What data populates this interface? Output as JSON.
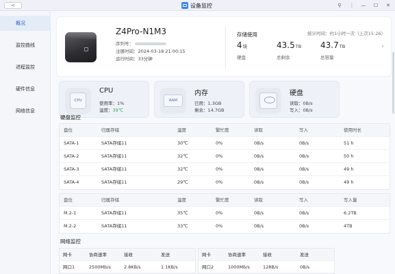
{
  "titlebar": {
    "back": "<",
    "title": "设备监控",
    "controls": [
      "⚲",
      "⋮",
      "—",
      "☐",
      "✕"
    ]
  },
  "sidebar": {
    "items": [
      {
        "label": "概况",
        "active": true
      },
      {
        "label": "监控曲线"
      },
      {
        "label": "进程监控"
      },
      {
        "label": "硬件信息"
      },
      {
        "label": "网络信息"
      }
    ]
  },
  "device": {
    "model": "Z4Pro-N1M3",
    "serial_label": "序列号：",
    "register_label": "注册时间：",
    "register_time": "2024-03-18 21:00:15",
    "uptime_label": "运行时间：",
    "uptime": "33分钟"
  },
  "storage": {
    "title": "存储使用",
    "stat_time": "统计时间：约1小时一次（上次15:26）",
    "disks": {
      "value": "4",
      "unit": "块",
      "label": "硬盘"
    },
    "remaining": {
      "value": "43.5",
      "unit": "TB",
      "label": "总剩余"
    },
    "capacity": {
      "value": "43.7",
      "unit": "TB",
      "label": "总容量"
    },
    "chevron": "›"
  },
  "resources": {
    "cpu": {
      "title": "CPU",
      "chip_text": "CPU",
      "usage_label": "使用率：",
      "usage": "1%",
      "temp_label": "温度：",
      "temp": "39℃"
    },
    "memory": {
      "title": "内存",
      "chip_text": "RAM",
      "used_label": "已用：",
      "used": "1.3GB",
      "free_label": "剩余：",
      "free": "14.7GB"
    },
    "disk": {
      "title": "硬盘",
      "read_label": "读取：",
      "read": "0B/s",
      "write_label": "写入：",
      "write": "0B/s"
    }
  },
  "disk_monitor": {
    "title": "硬盘监控",
    "sata_headers": [
      "盘位",
      "归属存储",
      "温度",
      "繁忙度",
      "读取",
      "写入",
      "使用时长"
    ],
    "sata_rows": [
      [
        "SATA-1",
        "SATA存储11",
        "30℃",
        "0%",
        "0B/s",
        "0B/s",
        "51 h"
      ],
      [
        "SATA-2",
        "SATA存储11",
        "32℃",
        "0%",
        "0B/s",
        "0B/s",
        "50 h"
      ],
      [
        "SATA-3",
        "SATA存储11",
        "32℃",
        "0%",
        "0B/s",
        "0B/s",
        "49 h"
      ],
      [
        "SATA-4",
        "SATA存储11",
        "29℃",
        "0%",
        "0B/s",
        "0B/s",
        "49 h"
      ]
    ],
    "m2_headers": [
      "盘位",
      "归属存储",
      "温度",
      "繁忙度",
      "读取",
      "写入",
      "写入量"
    ],
    "m2_rows": [
      [
        "M.2-1",
        "SATA存储11",
        "35℃",
        "0%",
        "0B/s",
        "0B/s",
        "6.2TB"
      ],
      [
        "M.2-2",
        "SATA存储11",
        "33℃",
        "0%",
        "0B/s",
        "0B/s",
        "4TB"
      ]
    ]
  },
  "network": {
    "title": "网络监控",
    "headers": [
      "网卡",
      "协商速率",
      "接收",
      "发送"
    ],
    "rows": [
      [
        "网口1",
        "2500Mb/s",
        "2.8KB/s",
        "1.1KB/s"
      ],
      [
        "网口2",
        "1000Mb/s",
        "128B/s",
        "0B/s"
      ]
    ]
  }
}
